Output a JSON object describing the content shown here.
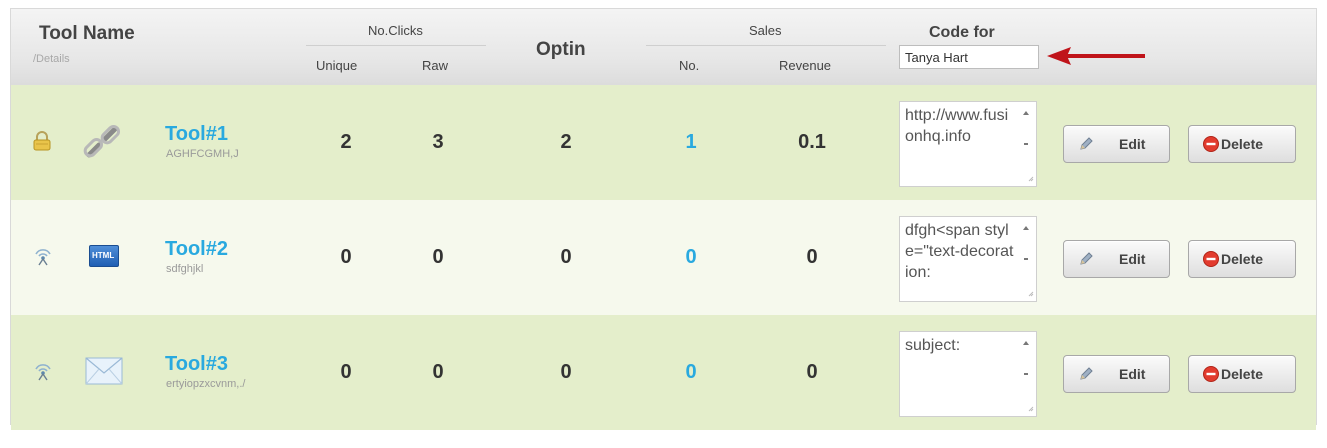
{
  "header": {
    "tool_name": "Tool Name",
    "details": "/Details",
    "no_clicks": "No.Clicks",
    "unique": "Unique",
    "raw": "Raw",
    "optin": "Optin",
    "sales": "Sales",
    "no": "No.",
    "revenue": "Revenue",
    "code_for": "Code for",
    "code_for_value": "Tanya Hart"
  },
  "rows": [
    {
      "status_icon": "lock-icon",
      "type_icon": "chain-link-icon",
      "name": "Tool#1",
      "detail": "AGHFCGMH,J",
      "unique": "2",
      "raw": "3",
      "optin": "2",
      "sales_no": "1",
      "revenue": "0.1",
      "code": "http://www.fusionhq.info",
      "edit_label": "Edit",
      "delete_label": "Delete"
    },
    {
      "status_icon": "broadcast-icon",
      "type_icon": "html-icon",
      "type_icon_text": "HTML",
      "name": "Tool#2",
      "detail": "sdfghjkl",
      "unique": "0",
      "raw": "0",
      "optin": "0",
      "sales_no": "0",
      "revenue": "0",
      "code": "dfgh<span style=\"text-decoration:",
      "edit_label": "Edit",
      "delete_label": "Delete"
    },
    {
      "status_icon": "broadcast-icon",
      "type_icon": "envelope-icon",
      "name": "Tool#3",
      "detail": "ertyiopzxcvnm,./",
      "unique": "0",
      "raw": "0",
      "optin": "0",
      "sales_no": "0",
      "revenue": "0",
      "code": "subject:",
      "edit_label": "Edit",
      "delete_label": "Delete"
    }
  ],
  "colors": {
    "link_blue": "#29a9df",
    "row_green": "#e4eecb",
    "row_light": "#f6f9ed",
    "arrow_red": "#c0141a",
    "delete_red": "#e23b2e"
  }
}
